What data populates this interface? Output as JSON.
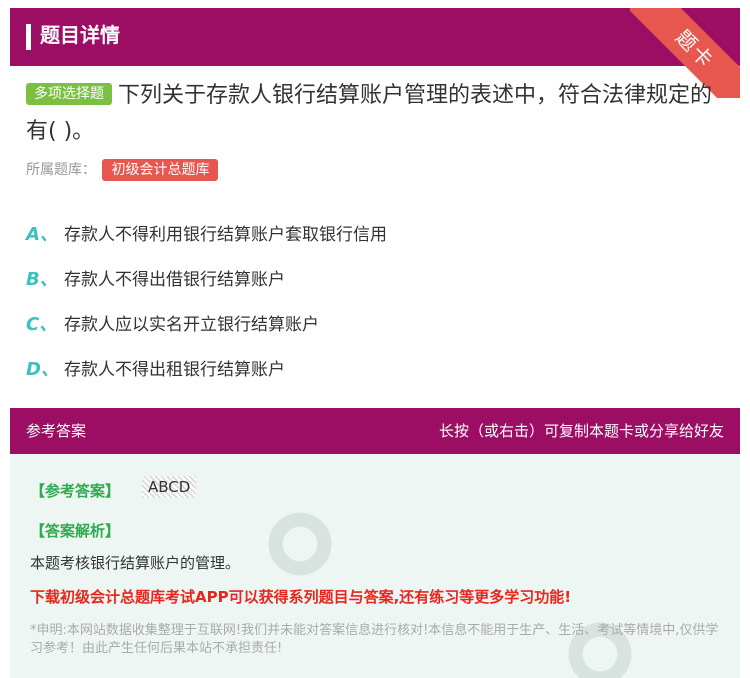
{
  "header": {
    "title": "题目详情",
    "corner_label": "题卡"
  },
  "question": {
    "type_badge": "多项选择题",
    "text": "下列关于存款人银行结算账户管理的表述中，符合法律规定的有( )。",
    "source_label": "所属题库：",
    "source_name": "初级会计总题库"
  },
  "options": [
    {
      "letter": "A、",
      "text": "存款人不得利用银行结算账户套取银行信用"
    },
    {
      "letter": "B、",
      "text": "存款人不得出借银行结算账户"
    },
    {
      "letter": "C、",
      "text": "存款人应以实名开立银行结算账户"
    },
    {
      "letter": "D、",
      "text": "存款人不得出租银行结算账户"
    }
  ],
  "answer_bar": {
    "left": "参考答案",
    "right": "长按（或右击）可复制本题卡或分享给好友"
  },
  "answer": {
    "label": "【参考答案】",
    "value": "ABCD",
    "analysis_label": "【答案解析】",
    "analysis_text": "本题考核银行结算账户的管理。",
    "promo": "下载初级会计总题库考试APP可以获得系列题目与答案,还有练习等更多学习功能!",
    "disclaimer": "*申明:本网站数据收集整理于互联网!我们并未能对答案信息进行核对!本信息不能用于生产、生活、考试等情境中,仅供学习参考！由此产生任何后果本站不承担责任!"
  }
}
